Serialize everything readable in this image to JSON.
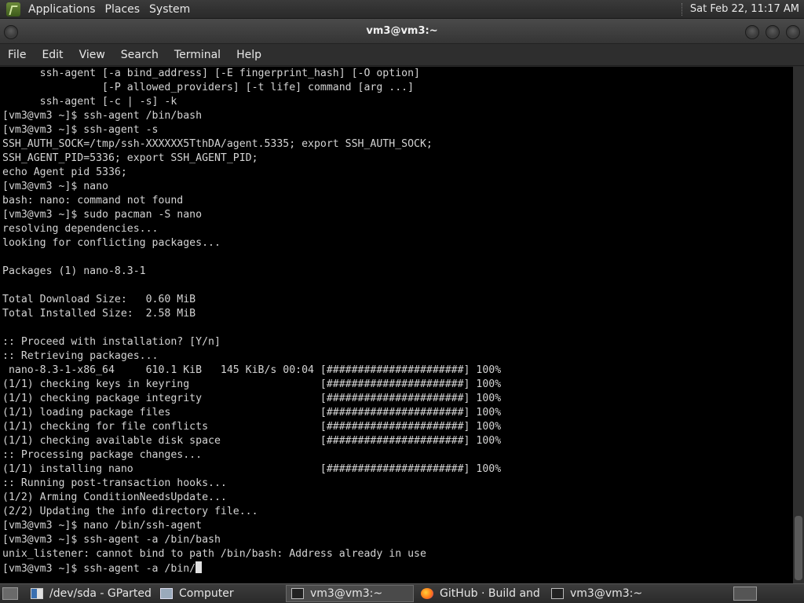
{
  "top_panel": {
    "menus": [
      "Applications",
      "Places",
      "System"
    ],
    "clock": "Sat Feb 22, 11:17 AM"
  },
  "window": {
    "title": "vm3@vm3:~"
  },
  "menubar": [
    "File",
    "Edit",
    "View",
    "Search",
    "Terminal",
    "Help"
  ],
  "terminal": {
    "lines": [
      "      ssh-agent [-a bind_address] [-E fingerprint_hash] [-O option]",
      "                [-P allowed_providers] [-t life] command [arg ...]",
      "      ssh-agent [-c | -s] -k",
      "[vm3@vm3 ~]$ ssh-agent /bin/bash",
      "[vm3@vm3 ~]$ ssh-agent -s",
      "SSH_AUTH_SOCK=/tmp/ssh-XXXXXX5TthDA/agent.5335; export SSH_AUTH_SOCK;",
      "SSH_AGENT_PID=5336; export SSH_AGENT_PID;",
      "echo Agent pid 5336;",
      "[vm3@vm3 ~]$ nano",
      "bash: nano: command not found",
      "[vm3@vm3 ~]$ sudo pacman -S nano",
      "resolving dependencies...",
      "looking for conflicting packages...",
      "",
      "Packages (1) nano-8.3-1",
      "",
      "Total Download Size:   0.60 MiB",
      "Total Installed Size:  2.58 MiB",
      "",
      ":: Proceed with installation? [Y/n]",
      ":: Retrieving packages...",
      " nano-8.3-1-x86_64     610.1 KiB   145 KiB/s 00:04 [######################] 100%",
      "(1/1) checking keys in keyring                     [######################] 100%",
      "(1/1) checking package integrity                   [######################] 100%",
      "(1/1) loading package files                        [######################] 100%",
      "(1/1) checking for file conflicts                  [######################] 100%",
      "(1/1) checking available disk space                [######################] 100%",
      ":: Processing package changes...",
      "(1/1) installing nano                              [######################] 100%",
      ":: Running post-transaction hooks...",
      "(1/2) Arming ConditionNeedsUpdate...",
      "(2/2) Updating the info directory file...",
      "[vm3@vm3 ~]$ nano /bin/ssh-agent",
      "[vm3@vm3 ~]$ ssh-agent -a /bin/bash",
      "unix_listener: cannot bind to path /bin/bash: Address already in use"
    ],
    "prompt_line": "[vm3@vm3 ~]$ ssh-agent -a /bin/"
  },
  "taskbar": {
    "tasks": [
      {
        "label": "/dev/sda - GParted (...",
        "icon": "gparted-icon"
      },
      {
        "label": "Computer",
        "icon": "computer-icon"
      },
      {
        "label": "vm3@vm3:~",
        "icon": "terminal-icon"
      },
      {
        "label": "GitHub · Build and s...",
        "icon": "firefox-icon"
      },
      {
        "label": "vm3@vm3:~",
        "icon": "terminal-icon"
      }
    ]
  }
}
